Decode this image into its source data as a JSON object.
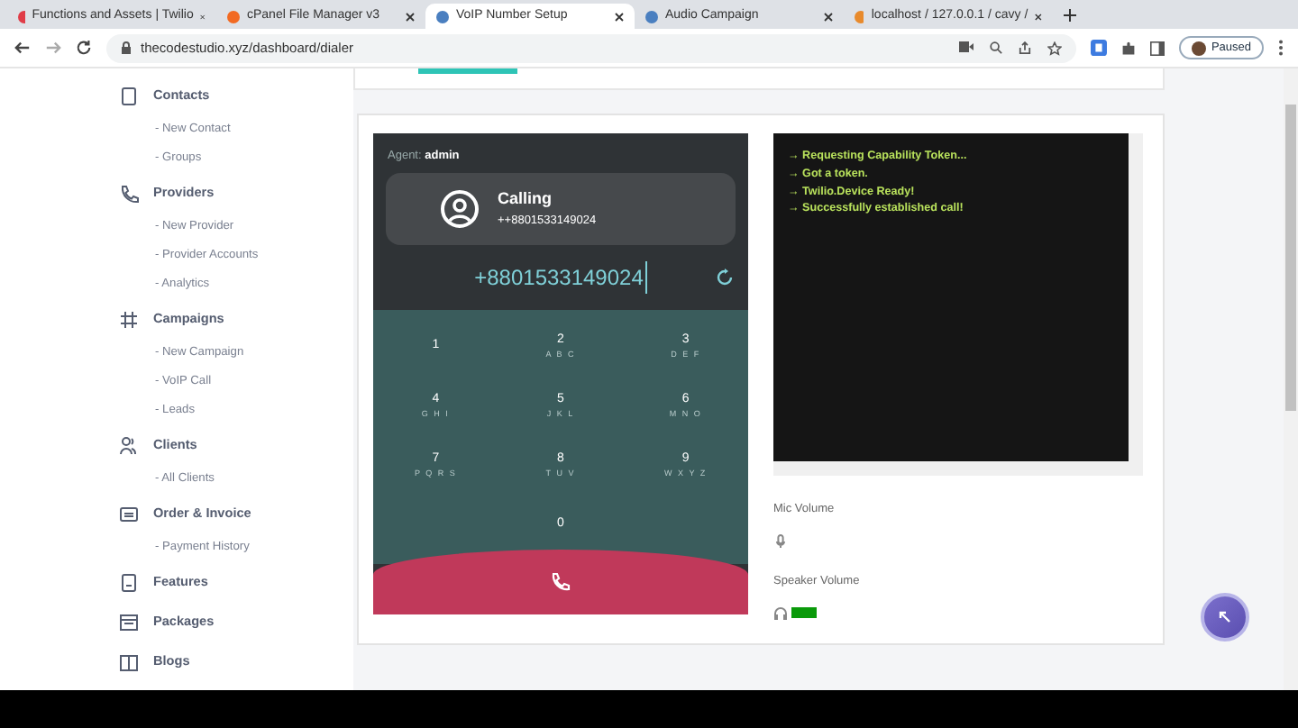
{
  "browser": {
    "tabs": [
      {
        "label": "Functions and Assets | Twilio",
        "selected": false
      },
      {
        "label": "cPanel File Manager v3",
        "selected": false
      },
      {
        "label": "VoIP Number Setup",
        "selected": true
      },
      {
        "label": "Audio Campaign",
        "selected": false
      },
      {
        "label": "localhost / 127.0.0.1 / cavy /",
        "selected": false
      }
    ],
    "address": "thecodestudio.xyz/dashboard/dialer",
    "profile": "Paused"
  },
  "sidebar": {
    "sections": [
      {
        "label": "Contacts",
        "children": [
          {
            "label": "- New Contact"
          },
          {
            "label": "- Groups"
          }
        ]
      },
      {
        "label": "Providers",
        "children": [
          {
            "label": "- New Provider"
          },
          {
            "label": "- Provider Accounts"
          },
          {
            "label": "- Analytics"
          }
        ]
      },
      {
        "label": "Campaigns",
        "children": [
          {
            "label": "- New Campaign"
          },
          {
            "label": "- VoIP Call"
          },
          {
            "label": "- Leads"
          }
        ]
      },
      {
        "label": "Clients",
        "children": [
          {
            "label": "- All Clients"
          }
        ]
      },
      {
        "label": "Order & Invoice",
        "children": [
          {
            "label": "- Payment History"
          }
        ]
      },
      {
        "label": "Features"
      },
      {
        "label": "Packages"
      },
      {
        "label": "Blogs"
      }
    ]
  },
  "dialer": {
    "agent_label": "Agent:",
    "agent": "admin",
    "status": "Calling",
    "calling_number": "++8801533149024",
    "number": "+8801533149024",
    "keys": [
      {
        "digit": "1"
      },
      {
        "digit": "2",
        "letters": "A B C"
      },
      {
        "digit": "3",
        "letters": "D E F"
      },
      {
        "digit": "4",
        "letters": "G H I"
      },
      {
        "digit": "5",
        "letters": "J K L"
      },
      {
        "digit": "6",
        "letters": "M N O"
      },
      {
        "digit": "7",
        "letters": "P Q R S"
      },
      {
        "digit": "8",
        "letters": "T U V"
      },
      {
        "digit": "9",
        "letters": "W X Y Z"
      },
      {
        "digit": "0"
      }
    ]
  },
  "log": {
    "lines": [
      "→ Requesting Capability Token...",
      "→ Got a token.",
      "→ Twilio.Device Ready!",
      "→ Successfully established call!"
    ]
  },
  "volumes": [
    {
      "label": "Mic Volume"
    },
    {
      "label": "Speaker Volume"
    }
  ]
}
